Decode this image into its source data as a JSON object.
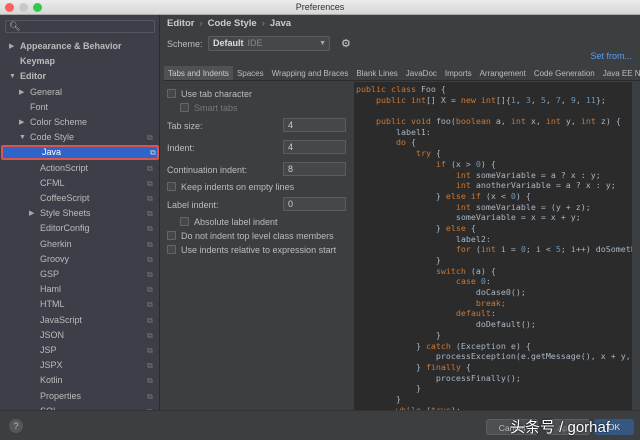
{
  "window": {
    "title": "Preferences"
  },
  "sidebar": {
    "search_placeholder": "",
    "items": [
      {
        "label": "Appearance & Behavior",
        "arrow": "▶"
      },
      {
        "label": "Keymap",
        "arrow": ""
      },
      {
        "label": "Editor",
        "arrow": "▼"
      },
      {
        "label": "General",
        "arrow": "▶"
      },
      {
        "label": "Font",
        "arrow": ""
      },
      {
        "label": "Color Scheme",
        "arrow": "▶"
      },
      {
        "label": "Code Style",
        "arrow": "▼"
      },
      {
        "label": "Java",
        "arrow": ""
      },
      {
        "label": "ActionScript",
        "arrow": ""
      },
      {
        "label": "CFML",
        "arrow": ""
      },
      {
        "label": "CoffeeScript",
        "arrow": ""
      },
      {
        "label": "Style Sheets",
        "arrow": "▶"
      },
      {
        "label": "EditorConfig",
        "arrow": ""
      },
      {
        "label": "Gherkin",
        "arrow": ""
      },
      {
        "label": "Groovy",
        "arrow": ""
      },
      {
        "label": "GSP",
        "arrow": ""
      },
      {
        "label": "Haml",
        "arrow": ""
      },
      {
        "label": "HTML",
        "arrow": ""
      },
      {
        "label": "JavaScript",
        "arrow": ""
      },
      {
        "label": "JSON",
        "arrow": ""
      },
      {
        "label": "JSP",
        "arrow": ""
      },
      {
        "label": "JSPX",
        "arrow": ""
      },
      {
        "label": "Kotlin",
        "arrow": ""
      },
      {
        "label": "Properties",
        "arrow": ""
      },
      {
        "label": "SQL",
        "arrow": ""
      }
    ],
    "selected": "Java"
  },
  "breadcrumb": [
    "Editor",
    "Code Style",
    "Java"
  ],
  "scheme": {
    "label": "Scheme:",
    "value": "Default",
    "tag": "IDE",
    "set_from": "Set from..."
  },
  "tabs": [
    "Tabs and Indents",
    "Spaces",
    "Wrapping and Braces",
    "Blank Lines",
    "JavaDoc",
    "Imports",
    "Arrangement",
    "Code Generation",
    "Java EE Names"
  ],
  "active_tab": "Tabs and Indents",
  "form": {
    "use_tab_character": {
      "label": "Use tab character",
      "checked": false
    },
    "smart_tabs": {
      "label": "Smart tabs",
      "checked": false,
      "disabled": true
    },
    "tab_size": {
      "label": "Tab size:",
      "value": "4"
    },
    "indent": {
      "label": "Indent:",
      "value": "4"
    },
    "continuation_indent": {
      "label": "Continuation indent:",
      "value": "8"
    },
    "keep_indents": {
      "label": "Keep indents on empty lines",
      "checked": false
    },
    "label_indent": {
      "label": "Label indent:",
      "value": "0"
    },
    "absolute_label_indent": {
      "label": "Absolute label indent",
      "checked": false
    },
    "no_indent_top_level": {
      "label": "Do not indent top level class members",
      "checked": false
    },
    "relative_indents": {
      "label": "Use indents relative to expression start",
      "checked": false
    }
  },
  "code_lines": [
    [
      [
        "k",
        "public class "
      ],
      [
        "t",
        "Foo {"
      ]
    ],
    [
      [
        "t",
        "    "
      ],
      [
        "k",
        "public int"
      ],
      [
        "t",
        "[] X = "
      ],
      [
        "k",
        "new int"
      ],
      [
        "t",
        "[]{"
      ],
      [
        "n",
        "1"
      ],
      [
        "t",
        ", "
      ],
      [
        "n",
        "3"
      ],
      [
        "t",
        ", "
      ],
      [
        "n",
        "5"
      ],
      [
        "t",
        ", "
      ],
      [
        "n",
        "7"
      ],
      [
        "t",
        ", "
      ],
      [
        "n",
        "9"
      ],
      [
        "t",
        ", "
      ],
      [
        "n",
        "11"
      ],
      [
        "t",
        "};"
      ]
    ],
    [],
    [
      [
        "t",
        "    "
      ],
      [
        "k",
        "public void "
      ],
      [
        "t",
        "foo("
      ],
      [
        "k",
        "boolean "
      ],
      [
        "t",
        "a, "
      ],
      [
        "k",
        "int "
      ],
      [
        "t",
        "x, "
      ],
      [
        "k",
        "int "
      ],
      [
        "t",
        "y, "
      ],
      [
        "k",
        "int "
      ],
      [
        "t",
        "z) {"
      ]
    ],
    [
      [
        "t",
        "        label1:"
      ]
    ],
    [
      [
        "t",
        "        "
      ],
      [
        "k",
        "do "
      ],
      [
        "t",
        "{"
      ]
    ],
    [
      [
        "t",
        "            "
      ],
      [
        "k",
        "try "
      ],
      [
        "t",
        "{"
      ]
    ],
    [
      [
        "t",
        "                "
      ],
      [
        "k",
        "if "
      ],
      [
        "t",
        "(x > "
      ],
      [
        "n",
        "0"
      ],
      [
        "t",
        ") {"
      ]
    ],
    [
      [
        "t",
        "                    "
      ],
      [
        "k",
        "int "
      ],
      [
        "t",
        "someVariable = a ? x : y;"
      ]
    ],
    [
      [
        "t",
        "                    "
      ],
      [
        "k",
        "int "
      ],
      [
        "t",
        "anotherVariable = a ? x : y;"
      ]
    ],
    [
      [
        "t",
        "                } "
      ],
      [
        "k",
        "else if "
      ],
      [
        "t",
        "(x < "
      ],
      [
        "n",
        "0"
      ],
      [
        "t",
        ") {"
      ]
    ],
    [
      [
        "t",
        "                    "
      ],
      [
        "k",
        "int "
      ],
      [
        "t",
        "someVariable = (y + z);"
      ]
    ],
    [
      [
        "t",
        "                    someVariable = x = x + y;"
      ]
    ],
    [
      [
        "t",
        "                } "
      ],
      [
        "k",
        "else "
      ],
      [
        "t",
        "{"
      ]
    ],
    [
      [
        "t",
        "                    label2:"
      ]
    ],
    [
      [
        "t",
        "                    "
      ],
      [
        "k",
        "for "
      ],
      [
        "t",
        "("
      ],
      [
        "k",
        "int "
      ],
      [
        "t",
        "i = "
      ],
      [
        "n",
        "0"
      ],
      [
        "t",
        "; i < "
      ],
      [
        "n",
        "5"
      ],
      [
        "t",
        "; i++) doSomething(i);"
      ]
    ],
    [
      [
        "t",
        "                }"
      ]
    ],
    [
      [
        "t",
        "                "
      ],
      [
        "k",
        "switch "
      ],
      [
        "t",
        "(a) {"
      ]
    ],
    [
      [
        "t",
        "                    "
      ],
      [
        "k",
        "case "
      ],
      [
        "n",
        "0"
      ],
      [
        "t",
        ":"
      ]
    ],
    [
      [
        "t",
        "                        doCase0();"
      ]
    ],
    [
      [
        "t",
        "                        "
      ],
      [
        "k",
        "break;"
      ]
    ],
    [
      [
        "t",
        "                    "
      ],
      [
        "k",
        "default"
      ],
      [
        "t",
        ":"
      ]
    ],
    [
      [
        "t",
        "                        doDefault();"
      ]
    ],
    [
      [
        "t",
        "                }"
      ]
    ],
    [
      [
        "t",
        "            } "
      ],
      [
        "k",
        "catch "
      ],
      [
        "t",
        "(Exception e) {"
      ]
    ],
    [
      [
        "t",
        "                processException(e.getMessage(), x + y, z, a);"
      ]
    ],
    [
      [
        "t",
        "            } "
      ],
      [
        "k",
        "finally "
      ],
      [
        "t",
        "{"
      ]
    ],
    [
      [
        "t",
        "                processFinally();"
      ]
    ],
    [
      [
        "t",
        "            }"
      ]
    ],
    [
      [
        "t",
        "        }"
      ]
    ],
    [
      [
        "t",
        "        "
      ],
      [
        "k",
        "while "
      ],
      [
        "t",
        "("
      ],
      [
        "k",
        "true"
      ],
      [
        "t",
        ");"
      ]
    ]
  ],
  "buttons": {
    "help": "?",
    "cancel": "Cancel",
    "apply": "Apply",
    "ok": "OK"
  },
  "watermark": "头条号 / gorhaf",
  "colors": {
    "selection": "#2f65ca",
    "highlight_border": "#d9534f",
    "keyword": "#cc7832",
    "number": "#6897bb",
    "code_text": "#a9b7c6",
    "link": "#589df6"
  }
}
